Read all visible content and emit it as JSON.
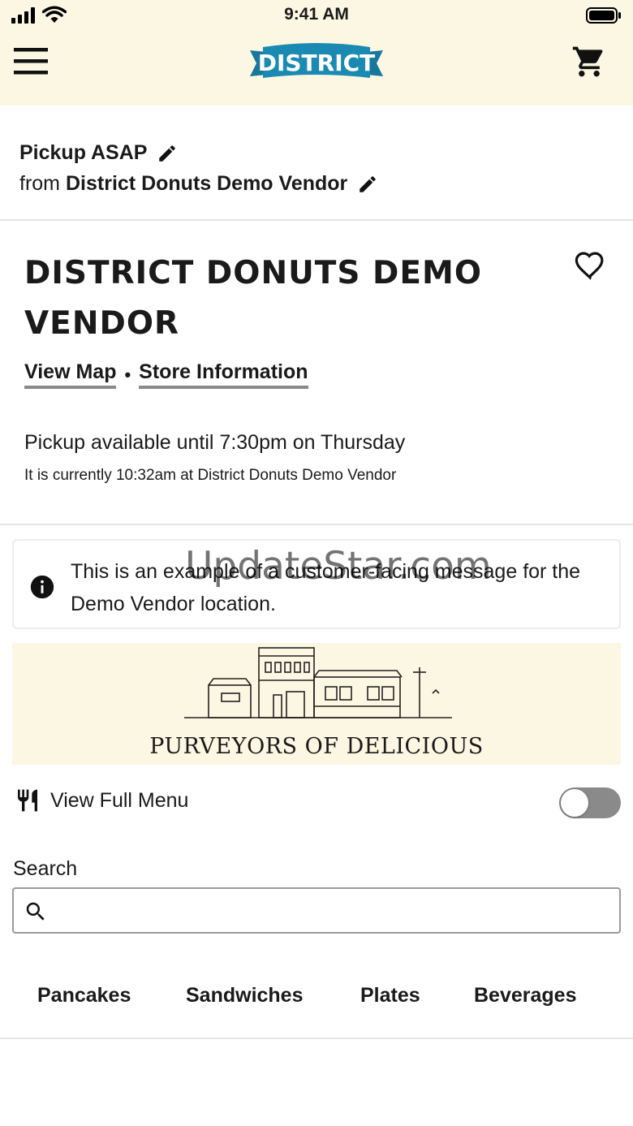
{
  "status_bar": {
    "time": "9:41 AM"
  },
  "header": {
    "logo_text": "DISTRICT",
    "brand_color": "#1a8ab3",
    "background": "#fcf7e3"
  },
  "pickup": {
    "mode": "Pickup ASAP",
    "from_prefix": "from",
    "vendor": "District Donuts Demo Vendor"
  },
  "store": {
    "title": "DISTRICT DONUTS DEMO VENDOR",
    "view_map": "View Map",
    "separator": "•",
    "store_info": "Store Information",
    "availability": "Pickup available until 7:30pm on Thursday",
    "current_time": "It is currently 10:32am at District Donuts Demo Vendor"
  },
  "message": {
    "text": "This is an example of a customer-facing message for the Demo Vendor location."
  },
  "banner": {
    "tagline": "PURVEYORS OF DELICIOUS"
  },
  "menu_toggle": {
    "label": "View Full Menu",
    "enabled": false
  },
  "search": {
    "label": "Search",
    "placeholder": ""
  },
  "tabs": [
    {
      "label": "Pancakes"
    },
    {
      "label": "Sandwiches"
    },
    {
      "label": "Plates"
    },
    {
      "label": "Beverages"
    }
  ],
  "watermark": "UpdateStar.com"
}
